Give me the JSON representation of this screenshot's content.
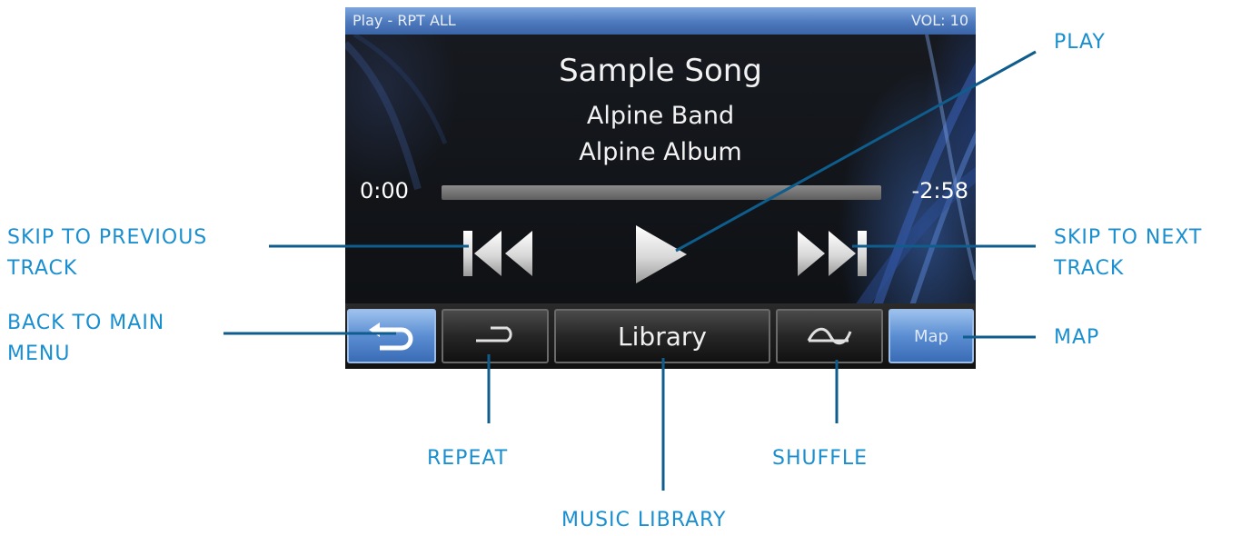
{
  "screen": {
    "status": {
      "left": "Play - RPT ALL",
      "right": "VOL: 10"
    },
    "song": {
      "title": "Sample Song",
      "artist": "Alpine Band",
      "album": "Alpine Album"
    },
    "progress": {
      "elapsed": "0:00",
      "remaining": "-2:58",
      "fraction": 0.0
    },
    "controls": {
      "previous_icon": "skip-previous-icon",
      "play_icon": "play-icon",
      "next_icon": "skip-next-icon"
    },
    "bottom_bar": {
      "back_icon": "back-arrow-icon",
      "repeat_icon": "repeat-icon",
      "library_label": "Library",
      "shuffle_icon": "shuffle-icon",
      "map_label": "Map"
    },
    "colors": {
      "status_bar": "#4d79bd",
      "blue_button": "#5a8dd2",
      "screen_bg": "#0d0f12"
    }
  },
  "callouts": {
    "play": "PLAY",
    "skip_previous_line1": "SKIP TO PREVIOUS",
    "skip_previous_line2": "TRACK",
    "skip_next_line1": "SKIP TO NEXT",
    "skip_next_line2": "TRACK",
    "back_line1": "BACK TO MAIN",
    "back_line2": "MENU",
    "map": "MAP",
    "repeat": "REPEAT",
    "shuffle": "SHUFFLE",
    "music_library": "MUSIC LIBRARY",
    "color": "#1a8fd0",
    "line_color": "#0f5d8c"
  }
}
